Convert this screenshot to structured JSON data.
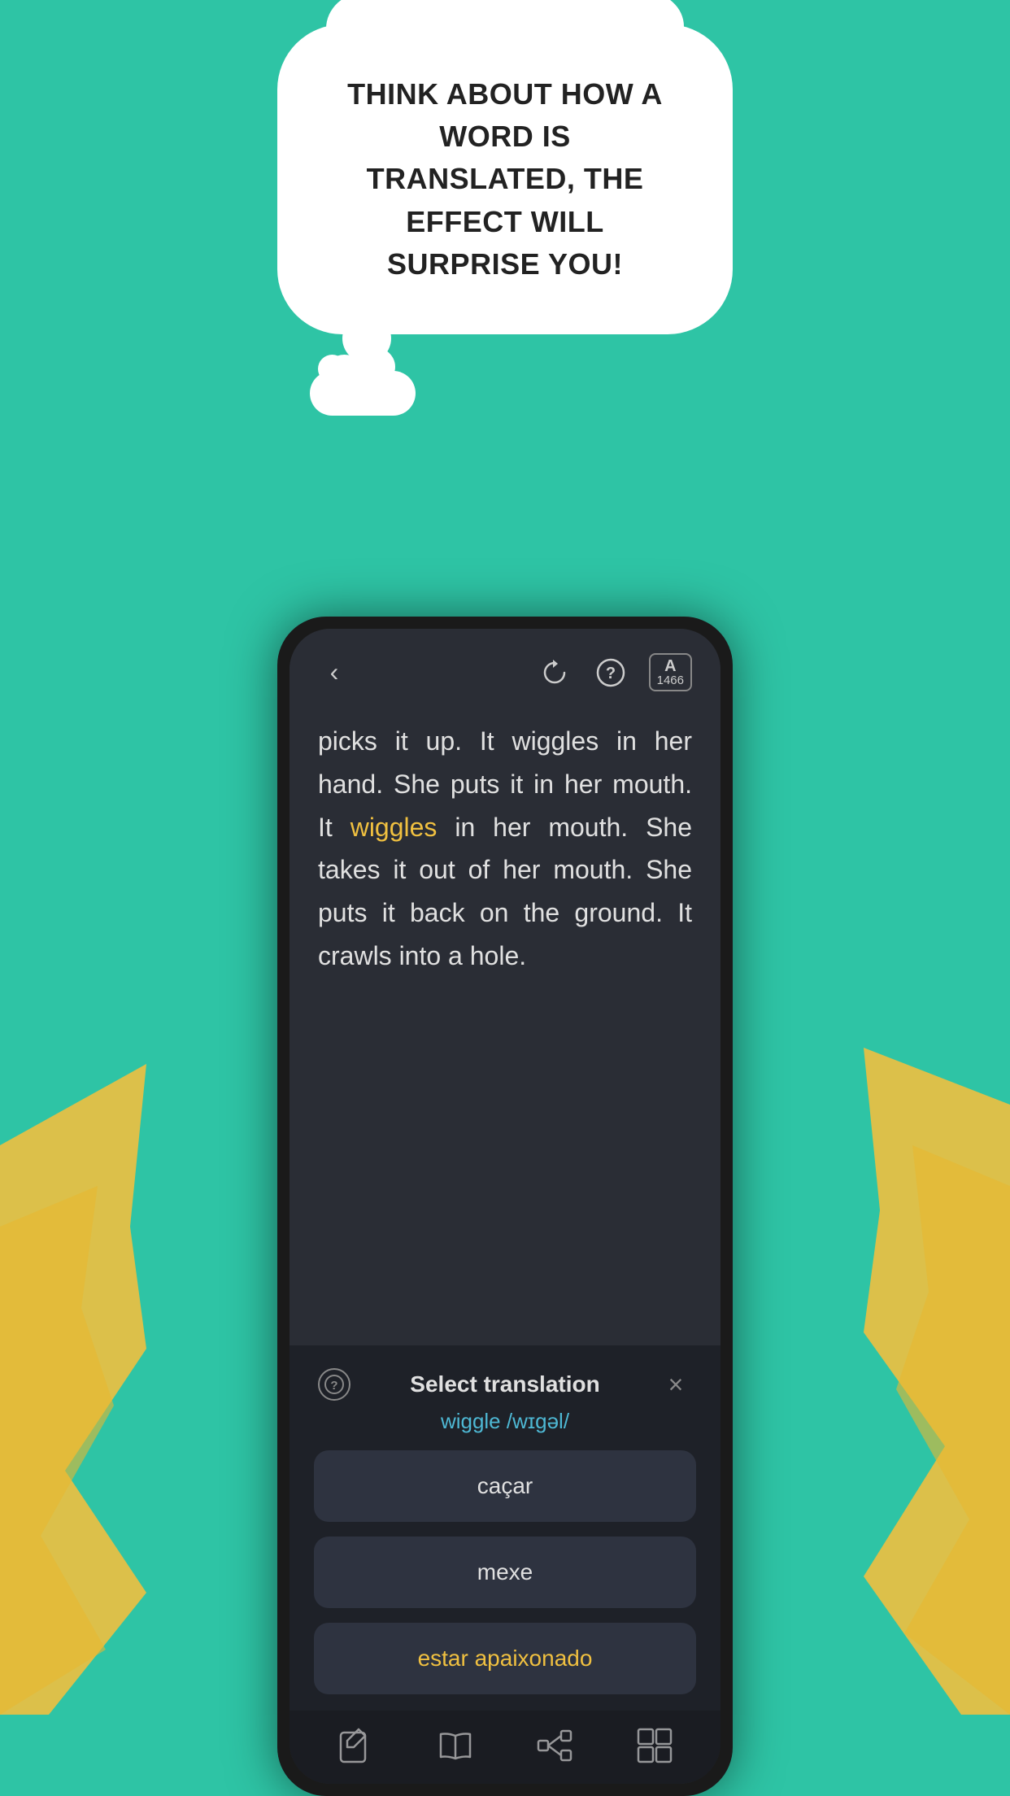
{
  "background": {
    "color": "#2ec4a5"
  },
  "cloud": {
    "text": "THINK ABOUT HOW A WORD IS TRANSLATED, THE EFFECT WILL SURPRISE YOU!"
  },
  "header": {
    "back_label": "‹",
    "refresh_label": "↻",
    "help_label": "?",
    "vocab_letter": "A",
    "vocab_count": "1466"
  },
  "reading": {
    "text_before": "picks it up. It wiggles in her hand. She puts it in her mouth. It ",
    "highlighted_word": "wiggles",
    "text_after": " in her mouth. She takes it out of her mouth. She puts it back on the ground. It crawls into a hole."
  },
  "translation_panel": {
    "title": "Select translation",
    "word": "wiggle /wɪɡəl/",
    "close_label": "×",
    "help_label": "?",
    "options": [
      {
        "label": "caçar",
        "color": "#e0e0e0"
      },
      {
        "label": "mexe",
        "color": "#e0e0e0"
      },
      {
        "label": "estar apaixonado",
        "color": "#f0c040"
      }
    ]
  },
  "bottom_nav": {
    "items": [
      {
        "name": "write",
        "label": "write-icon"
      },
      {
        "name": "read",
        "label": "read-icon"
      },
      {
        "name": "connect",
        "label": "connect-icon"
      },
      {
        "name": "grid",
        "label": "grid-icon"
      }
    ]
  }
}
